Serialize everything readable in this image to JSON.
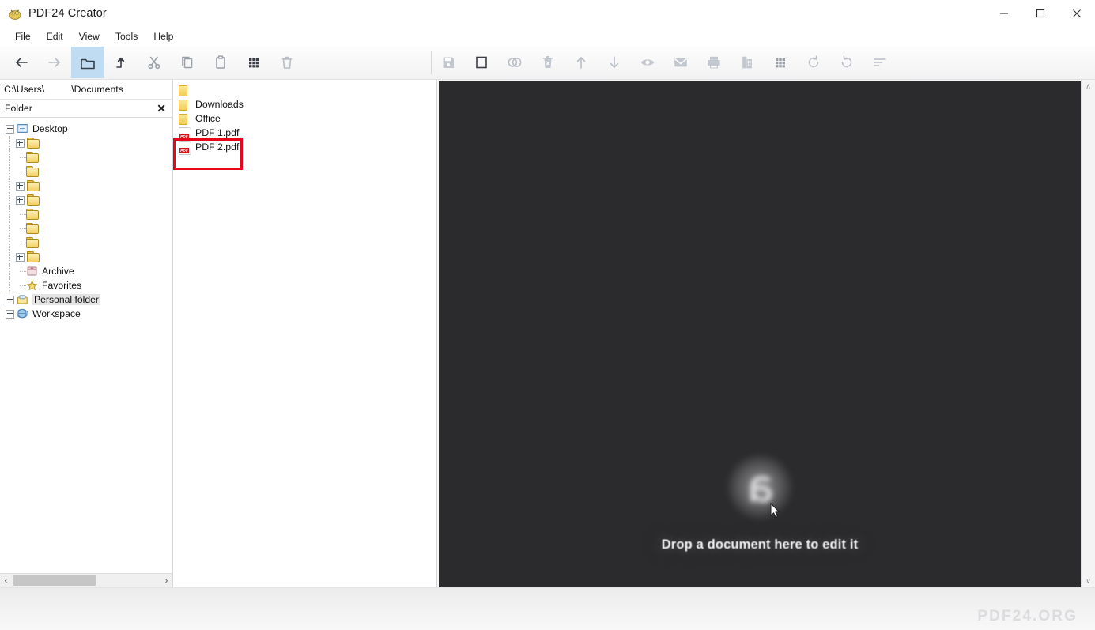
{
  "window": {
    "title": "PDF24 Creator",
    "app_icon": "pdf24-app-icon",
    "controls": {
      "minimize": "–",
      "maximize": "☐",
      "close": "×"
    }
  },
  "menubar": {
    "items": [
      {
        "label": "File"
      },
      {
        "label": "Edit"
      },
      {
        "label": "View"
      },
      {
        "label": "Tools"
      },
      {
        "label": "Help"
      }
    ]
  },
  "toolbar": {
    "left": [
      {
        "name": "back-arrow-icon",
        "label": "Back",
        "state": "enabled"
      },
      {
        "name": "forward-arrow-icon",
        "label": "Forward",
        "state": "disabled"
      },
      {
        "name": "folder-icon",
        "label": "Folder",
        "state": "active"
      },
      {
        "name": "up-arrow-icon",
        "label": "Up one level",
        "state": "enabled"
      },
      {
        "name": "scissors-icon",
        "label": "Cut",
        "state": "disabled"
      },
      {
        "name": "copy-icon",
        "label": "Copy",
        "state": "disabled"
      },
      {
        "name": "clipboard-paste-icon",
        "label": "Paste",
        "state": "disabled"
      },
      {
        "name": "grid-view-icon",
        "label": "Grid view",
        "state": "enabled"
      },
      {
        "name": "trash-icon",
        "label": "Delete",
        "state": "disabled"
      }
    ],
    "right": [
      {
        "name": "save-icon",
        "label": "Save",
        "state": "disabled"
      },
      {
        "name": "select-square-icon",
        "label": "Select all",
        "state": "enabled"
      },
      {
        "name": "merge-circles-icon",
        "label": "Merge",
        "state": "disabled"
      },
      {
        "name": "delete-page-icon",
        "label": "Delete page",
        "state": "disabled"
      },
      {
        "name": "move-up-icon",
        "label": "Move up",
        "state": "disabled"
      },
      {
        "name": "move-down-icon",
        "label": "Move down",
        "state": "disabled"
      },
      {
        "name": "preview-eye-icon",
        "label": "Preview",
        "state": "disabled"
      },
      {
        "name": "mail-icon",
        "label": "Send by email",
        "state": "disabled"
      },
      {
        "name": "print-icon",
        "label": "Print",
        "state": "disabled"
      },
      {
        "name": "fax-icon",
        "label": "Fax",
        "state": "disabled"
      },
      {
        "name": "page-grid-icon",
        "label": "Page grid",
        "state": "disabled"
      },
      {
        "name": "rotate-left-icon",
        "label": "Rotate left",
        "state": "disabled"
      },
      {
        "name": "rotate-right-icon",
        "label": "Rotate right",
        "state": "disabled"
      },
      {
        "name": "sort-icon",
        "label": "Sort",
        "state": "disabled"
      }
    ]
  },
  "path_bar": {
    "prefix": "C:\\Users\\",
    "suffix": "\\Documents"
  },
  "folder_panel": {
    "header": "Folder",
    "close_label": "✕",
    "tree": [
      {
        "label": "Desktop",
        "icon": "desktop-icon",
        "expander": "minus",
        "depth": 0,
        "selected": false
      },
      {
        "label": "",
        "icon": "folder-icon",
        "expander": "plus",
        "depth": 1,
        "selected": false
      },
      {
        "label": "",
        "icon": "folder-icon",
        "expander": "none",
        "depth": 1,
        "selected": false
      },
      {
        "label": "",
        "icon": "folder-icon",
        "expander": "none",
        "depth": 1,
        "selected": false
      },
      {
        "label": "",
        "icon": "folder-icon",
        "expander": "plus",
        "depth": 1,
        "selected": false
      },
      {
        "label": "",
        "icon": "folder-icon",
        "expander": "plus",
        "depth": 1,
        "selected": false
      },
      {
        "label": "",
        "icon": "folder-icon",
        "expander": "none",
        "depth": 1,
        "selected": false
      },
      {
        "label": "",
        "icon": "folder-icon",
        "expander": "none",
        "depth": 1,
        "selected": false
      },
      {
        "label": "",
        "icon": "folder-icon",
        "expander": "none",
        "depth": 1,
        "selected": false
      },
      {
        "label": "",
        "icon": "folder-icon",
        "expander": "plus",
        "depth": 1,
        "selected": false
      },
      {
        "label": "Archive",
        "icon": "archive-icon",
        "expander": "none",
        "depth": 0,
        "selected": false
      },
      {
        "label": "Favorites",
        "icon": "star-icon",
        "expander": "none",
        "depth": 0,
        "selected": false
      },
      {
        "label": "Personal folder",
        "icon": "personal-folder-icon",
        "expander": "plus",
        "depth": 0,
        "selected": true
      },
      {
        "label": "Workspace",
        "icon": "workspace-icon",
        "expander": "plus",
        "depth": 0,
        "selected": false
      }
    ],
    "hscroll": {
      "left_arrow": "‹",
      "right_arrow": "›"
    }
  },
  "file_list": {
    "items": [
      {
        "name": "",
        "type": "folder",
        "icon": "folder-icon",
        "highlighted": false
      },
      {
        "name": "Downloads",
        "type": "folder",
        "icon": "folder-icon",
        "highlighted": false
      },
      {
        "name": "Office",
        "type": "folder",
        "icon": "folder-icon",
        "highlighted": false
      },
      {
        "name": "PDF 1.pdf",
        "type": "pdf",
        "icon": "pdf-file-icon",
        "highlighted": true
      },
      {
        "name": "PDF 2.pdf",
        "type": "pdf",
        "icon": "pdf-file-icon",
        "highlighted": true
      }
    ],
    "pdf_badge_text": "PDF",
    "highlight_color": "#e8071a"
  },
  "editor": {
    "drop_text": "Drop a document here to edit it",
    "logo_glyph": "a",
    "background_color": "#2b2b2d",
    "cursor": "mouse-pointer"
  },
  "scrollbars": {
    "vertical_up": "∧",
    "vertical_down": "∨"
  },
  "footer": {
    "watermark": "PDF24.ORG"
  }
}
